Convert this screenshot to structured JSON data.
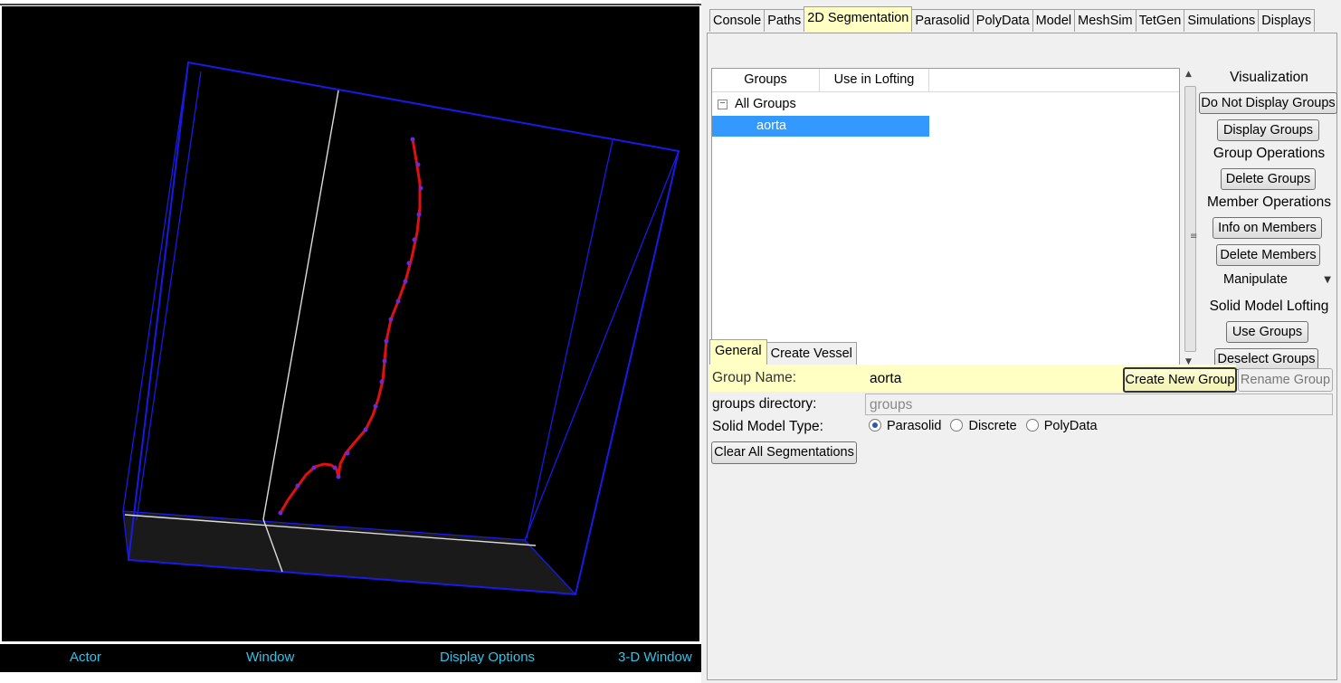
{
  "viewport": {
    "status": {
      "actor": "Actor",
      "window": "Window",
      "display_options": "Display Options",
      "window_3d": "3-D Window"
    },
    "colors": {
      "box": "#1a1ae6",
      "path": "#e01010",
      "point": "#6a2ad8",
      "status_text": "#2ec4e8"
    }
  },
  "tabs": {
    "main": [
      "Console",
      "Paths",
      "2D Segmentation",
      "Parasolid",
      "PolyData",
      "Model",
      "MeshSim",
      "TetGen",
      "Simulations",
      "Displays"
    ],
    "active": "2D Segmentation"
  },
  "tree": {
    "columns": [
      "Groups",
      "Use in Lofting"
    ],
    "root": "All Groups",
    "expander": "−",
    "items": [
      "aorta"
    ]
  },
  "side": {
    "visualization": "Visualization",
    "do_not_display": "Do Not Display Groups",
    "display_groups": "Display Groups",
    "group_operations": "Group Operations",
    "delete_groups": "Delete Groups",
    "member_operations": "Member Operations",
    "info_members": "Info on Members",
    "delete_members": "Delete Members",
    "manipulate": "Manipulate",
    "solid_lofting": "Solid Model Lofting",
    "use_groups": "Use Groups",
    "deselect_groups": "Deselect Groups"
  },
  "subtabs": {
    "items": [
      "General",
      "Create Vessel"
    ],
    "active": "General"
  },
  "form": {
    "group_name_label": "Group Name:",
    "group_name_value": "aorta",
    "create_new_group": "Create New Group",
    "rename_group": "Rename Group",
    "groups_dir_label": "groups directory:",
    "groups_dir_value": "groups",
    "solid_type_label": "Solid Model Type:",
    "solid_types": [
      "Parasolid",
      "Discrete",
      "PolyData"
    ],
    "solid_type_selected": "Parasolid",
    "clear_all": "Clear All Segmentations"
  }
}
